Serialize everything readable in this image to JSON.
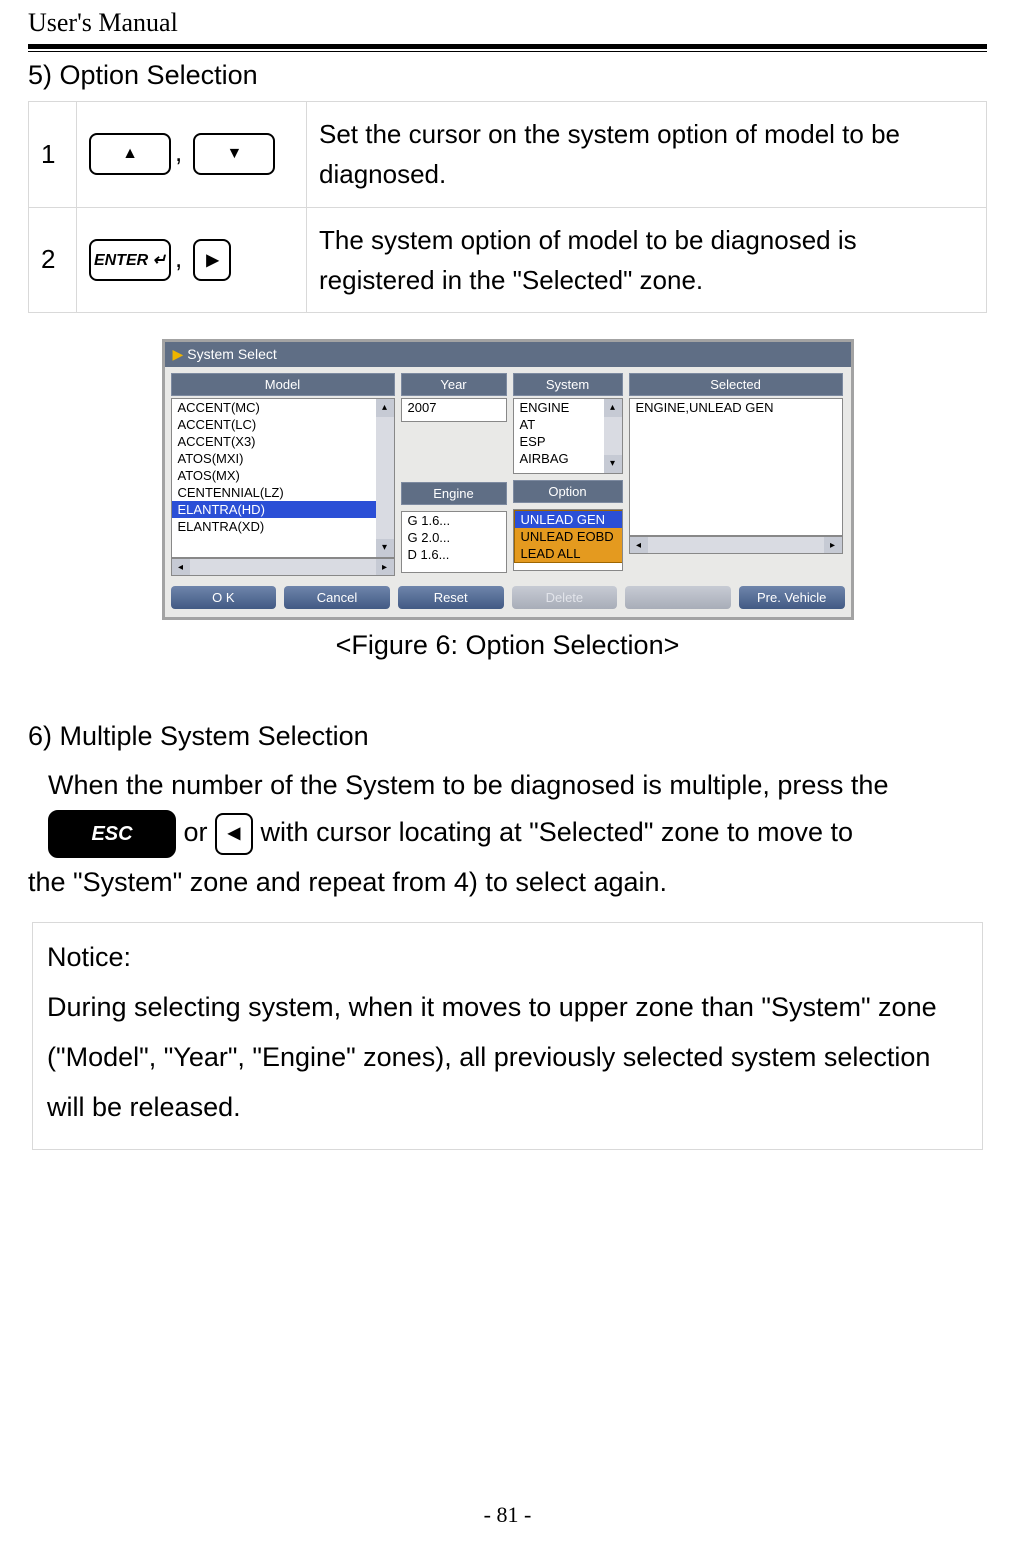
{
  "header": {
    "title": "User's Manual"
  },
  "section5": {
    "heading": "5) Option Selection",
    "rows": [
      {
        "num": "1",
        "key_up_glyph": "▲",
        "key_down_glyph": "▼",
        "desc": "Set the cursor on the system option of model to be diagnosed."
      },
      {
        "num": "2",
        "key_enter_label": "ENTER ↵",
        "key_right_glyph": "▶",
        "desc": "The system option of model to be diagnosed is registered in the \"Selected\" zone."
      }
    ]
  },
  "figure": {
    "title_marker": "▶",
    "title": "System Select",
    "headers": {
      "model": "Model",
      "year": "Year",
      "system": "System",
      "engine": "Engine",
      "option": "Option",
      "selected": "Selected"
    },
    "model_items": [
      "ACCENT(MC)",
      "ACCENT(LC)",
      "ACCENT(X3)",
      "ATOS(MXI)",
      "ATOS(MX)",
      "CENTENNIAL(LZ)",
      "ELANTRA(HD)",
      "ELANTRA(XD)"
    ],
    "model_selected_index": 6,
    "year_items": [
      "2007"
    ],
    "system_items": [
      "ENGINE",
      "AT",
      "ESP",
      "AIRBAG"
    ],
    "engine_items": [
      "G 1.6...",
      "G 2.0...",
      "D 1.6..."
    ],
    "option_items": [
      "UNLEAD GEN",
      "UNLEAD EOBD",
      "LEAD ALL"
    ],
    "option_selected_index": 0,
    "selected_value": "ENGINE,UNLEAD GEN",
    "buttons": {
      "ok": "O K",
      "cancel": "Cancel",
      "reset": "Reset",
      "delete": "Delete",
      "pre_vehicle": "Pre. Vehicle"
    },
    "caption": "<Figure 6: Option Selection>"
  },
  "section6": {
    "heading": "6) Multiple System Selection",
    "line1_pre": "When the number of the System to be diagnosed is multiple, press the",
    "esc_label": "ESC",
    "line1_mid": " or ",
    "left_glyph": "◀",
    "line1_post": " with cursor locating at \"Selected\" zone to move to",
    "line2": "the \"System\" zone and repeat from 4) to select again."
  },
  "notice": {
    "title": "Notice:",
    "body": "During selecting system, when it moves to upper zone than \"System\" zone (\"Model\", \"Year\", \"Engine\" zones), all previously selected system selection will be released."
  },
  "footer": {
    "page": "- 81 -"
  }
}
